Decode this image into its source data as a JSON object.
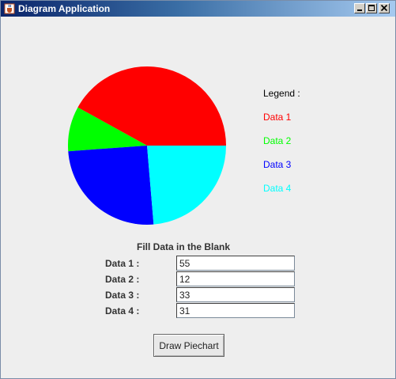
{
  "window": {
    "title": "Diagram Application"
  },
  "legend": {
    "heading": "Legend :",
    "items": [
      {
        "label": "Data 1",
        "color": "#ff0000"
      },
      {
        "label": "Data 2",
        "color": "#00ff00"
      },
      {
        "label": "Data 3",
        "color": "#0000ff"
      },
      {
        "label": "Data 4",
        "color": "#00ffff"
      }
    ]
  },
  "form": {
    "title": "Fill Data in the Blank",
    "fields": [
      {
        "label": "Data 1 :",
        "value": "55"
      },
      {
        "label": "Data 2 :",
        "value": "12"
      },
      {
        "label": "Data 3 :",
        "value": "33"
      },
      {
        "label": "Data 4 :",
        "value": "31"
      }
    ],
    "button_label": "Draw Piechart"
  },
  "chart_data": {
    "type": "pie",
    "title": "",
    "categories": [
      "Data 1",
      "Data 2",
      "Data 3",
      "Data 4"
    ],
    "values": [
      55,
      12,
      33,
      31
    ],
    "colors": [
      "#ff0000",
      "#00ff00",
      "#0000ff",
      "#00ffff"
    ],
    "legend": "right"
  }
}
